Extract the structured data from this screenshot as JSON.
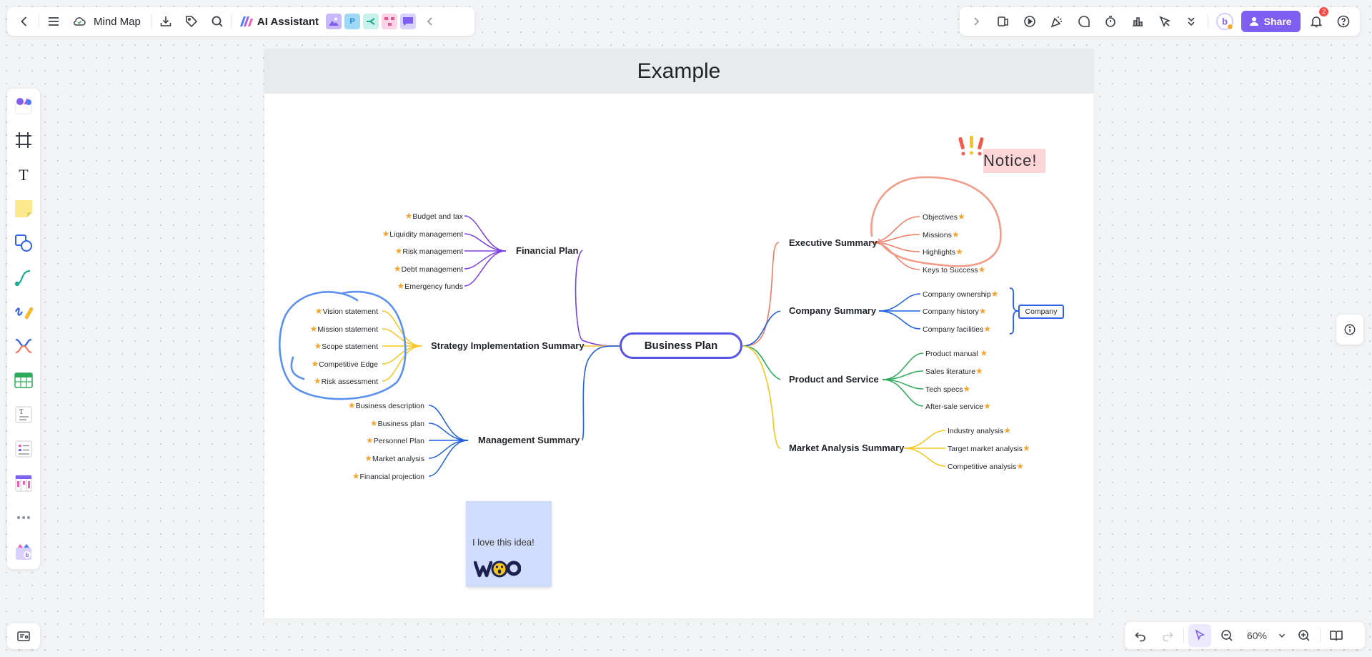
{
  "toolbar": {
    "doc_title": "Mind Map",
    "ai_label": "AI Assistant"
  },
  "topbar_right": {
    "share_label": "Share",
    "notification_count": "2"
  },
  "zoom": {
    "level": "60%"
  },
  "board": {
    "title": "Example",
    "root": "Business Plan",
    "left_branches": [
      {
        "label": "Financial Plan",
        "color": "#7b3fe4",
        "children": [
          "Budget and tax",
          "Liquidity management",
          "Risk management",
          "Debt management",
          "Emergency funds"
        ]
      },
      {
        "label": "Strategy Implementation Summary",
        "color": "#f5c61e",
        "children": [
          "Vision statement",
          "Mission statement",
          "Scope statement",
          "Competitive Edge",
          "Risk assessment"
        ]
      },
      {
        "label": "Management Summary",
        "color": "#1f5fe0",
        "children": [
          "Business description",
          "Business plan",
          "Personnel Plan",
          "Market analysis",
          "Financial  projection"
        ]
      }
    ],
    "right_branches": [
      {
        "label": "Executive Summary",
        "color": "#f07a62",
        "children": [
          "Objectives",
          "Missions",
          "Highlights",
          "Keys to Success"
        ]
      },
      {
        "label": "Company Summary",
        "color": "#1f5fe0",
        "children": [
          "Company ownership",
          "Company history",
          "Company facilities"
        ]
      },
      {
        "label": "Product and Service",
        "color": "#2eab5a",
        "children": [
          "Product manual",
          "Sales literature",
          "Tech specs",
          "After-sale service"
        ]
      },
      {
        "label": "Market Analysis Summary",
        "color": "#f5c61e",
        "children": [
          "Industry analysis",
          "Target market analysis",
          "Competitive analysis"
        ]
      }
    ],
    "summary_label": "Company",
    "notice_text": "Notice!",
    "sticky_text": "I love this idea!",
    "sticker_text": "WOO"
  }
}
